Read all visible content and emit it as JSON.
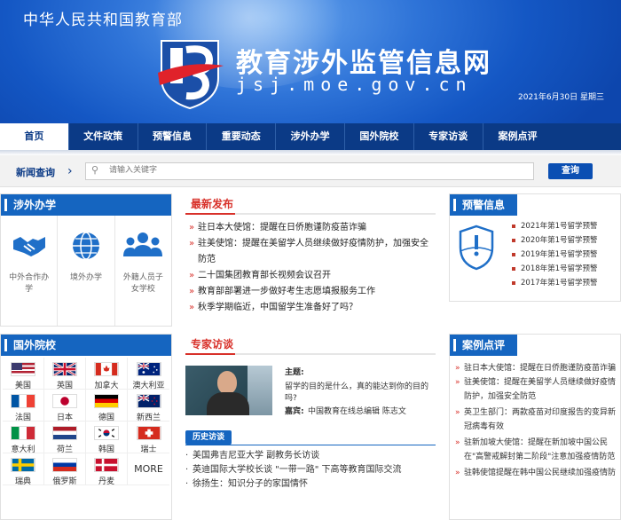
{
  "header": {
    "ministry": "中华人民共和国教育部",
    "site_title": "教育涉外监管信息网",
    "site_domain": "jsj.moe.gov.cn",
    "date": "2021年6月30日  星期三"
  },
  "nav": {
    "items": [
      {
        "label": "首页",
        "active": true
      },
      {
        "label": "文件政策"
      },
      {
        "label": "预警信息"
      },
      {
        "label": "重要动态"
      },
      {
        "label": "涉外办学"
      },
      {
        "label": "国外院校"
      },
      {
        "label": "专家访谈"
      },
      {
        "label": "案例点评"
      }
    ]
  },
  "search": {
    "label": "新闻查询",
    "placeholder": "请输入关键字",
    "button": "查询"
  },
  "overseas_schooling": {
    "title": "涉外办学",
    "items": [
      {
        "label": "中外合作办学",
        "icon": "handshake-icon"
      },
      {
        "label": "境外办学",
        "icon": "globe-icon"
      },
      {
        "label": "外籍人员子女学校",
        "icon": "people-icon"
      }
    ]
  },
  "foreign_schools": {
    "title": "国外院校",
    "countries": [
      "美国",
      "英国",
      "加拿大",
      "澳大利亚",
      "法国",
      "日本",
      "德国",
      "新西兰",
      "意大利",
      "荷兰",
      "韩国",
      "瑞士",
      "瑞典",
      "俄罗斯",
      "丹麦"
    ],
    "more": "MORE"
  },
  "latest": {
    "title": "最新发布",
    "items": [
      "驻日本大使馆：提醒在日侨胞谨防疫苗诈骗",
      "驻美使馆：提醒在美留学人员继续做好疫情防护，加强安全防范",
      "二十国集团教育部长视频会议召开",
      "教育部部署进一步做好考生志愿填报服务工作",
      "秋季学期临近，中国留学生准备好了吗？"
    ]
  },
  "interview": {
    "title": "专家访谈",
    "topic_label": "主题:",
    "topic": "留学的目的是什么，真的能达到你的目的吗?",
    "guest_label": "嘉宾:",
    "guest": "中国教育在线总编辑 陈志文",
    "history_tag": "历史访谈",
    "history": [
      "美国弗吉尼亚大学 副教务长访谈",
      "英迪国际大学校长谈 \"一带一路\" 下高等教育国际交流",
      "徐扬生：知识分子的家国情怀"
    ]
  },
  "warnings": {
    "title": "预警信息",
    "items": [
      "2021年第1号留学预警",
      "2020年第1号留学预警",
      "2019年第1号留学预警",
      "2018年第1号留学预警",
      "2017年第1号留学预警"
    ]
  },
  "cases": {
    "title": "案例点评",
    "items": [
      "驻日本大使馆：提醒在日侨胞谨防疫苗诈骗",
      "驻美使馆：提醒在美留学人员继续做好疫情防护，加强安全防范",
      "英卫生部门：两款疫苗对印度报告的变异新冠病毒有效",
      "驻新加坡大使馆：提醒在新加坡中国公民在\"高警戒解封第二阶段\"注意加强疫情防范",
      "驻韩使馆提醒在韩中国公民继续加强疫情防"
    ]
  },
  "colors": {
    "nav": "#0b3a86",
    "accent_blue": "#1565c0",
    "accent_red": "#d8312a"
  }
}
